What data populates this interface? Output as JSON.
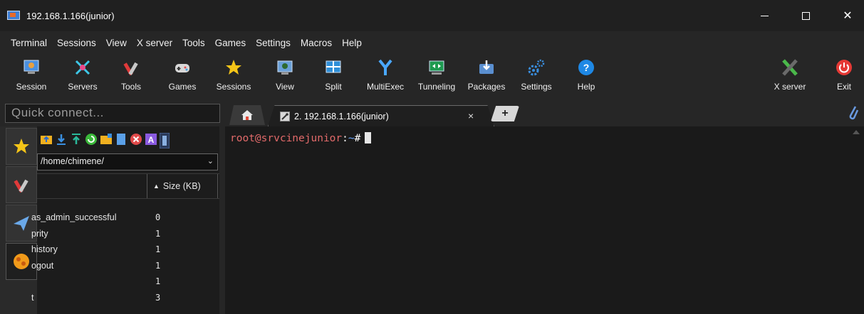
{
  "window": {
    "title": "192.168.1.166(junior)"
  },
  "menu": [
    "Terminal",
    "Sessions",
    "View",
    "X server",
    "Tools",
    "Games",
    "Settings",
    "Macros",
    "Help"
  ],
  "toolbar": {
    "session": "Session",
    "servers": "Servers",
    "tools": "Tools",
    "games": "Games",
    "sessions": "Sessions",
    "view": "View",
    "split": "Split",
    "multiexec": "MultiExec",
    "tunneling": "Tunneling",
    "packages": "Packages",
    "settings": "Settings",
    "help": "Help",
    "xserver": "X server",
    "exit": "Exit"
  },
  "quick_connect": {
    "placeholder": "Quick connect..."
  },
  "tabs": {
    "session_label": "2. 192.168.1.166(junior)",
    "close": "×",
    "new": "+"
  },
  "sftp": {
    "path": "/home/chimene/",
    "size_header": "Size (KB)",
    "files": [
      {
        "name": "as_admin_successful",
        "size": "0"
      },
      {
        "name": "prity",
        "size": "1"
      },
      {
        "name": "history",
        "size": "1"
      },
      {
        "name": "ogout",
        "size": "1"
      },
      {
        "name": "",
        "size": "1"
      },
      {
        "name": "t",
        "size": "3"
      }
    ]
  },
  "terminal": {
    "user_host": "root@srvcinejunior",
    "colon": ":",
    "path": "~",
    "symbol": "#"
  },
  "colors": {
    "background": "#1f1f1f",
    "prompt_user": "#e26a6a",
    "prompt_path": "#6aa7ff",
    "exit_red": "#e53935",
    "help_blue": "#1e88e5"
  }
}
